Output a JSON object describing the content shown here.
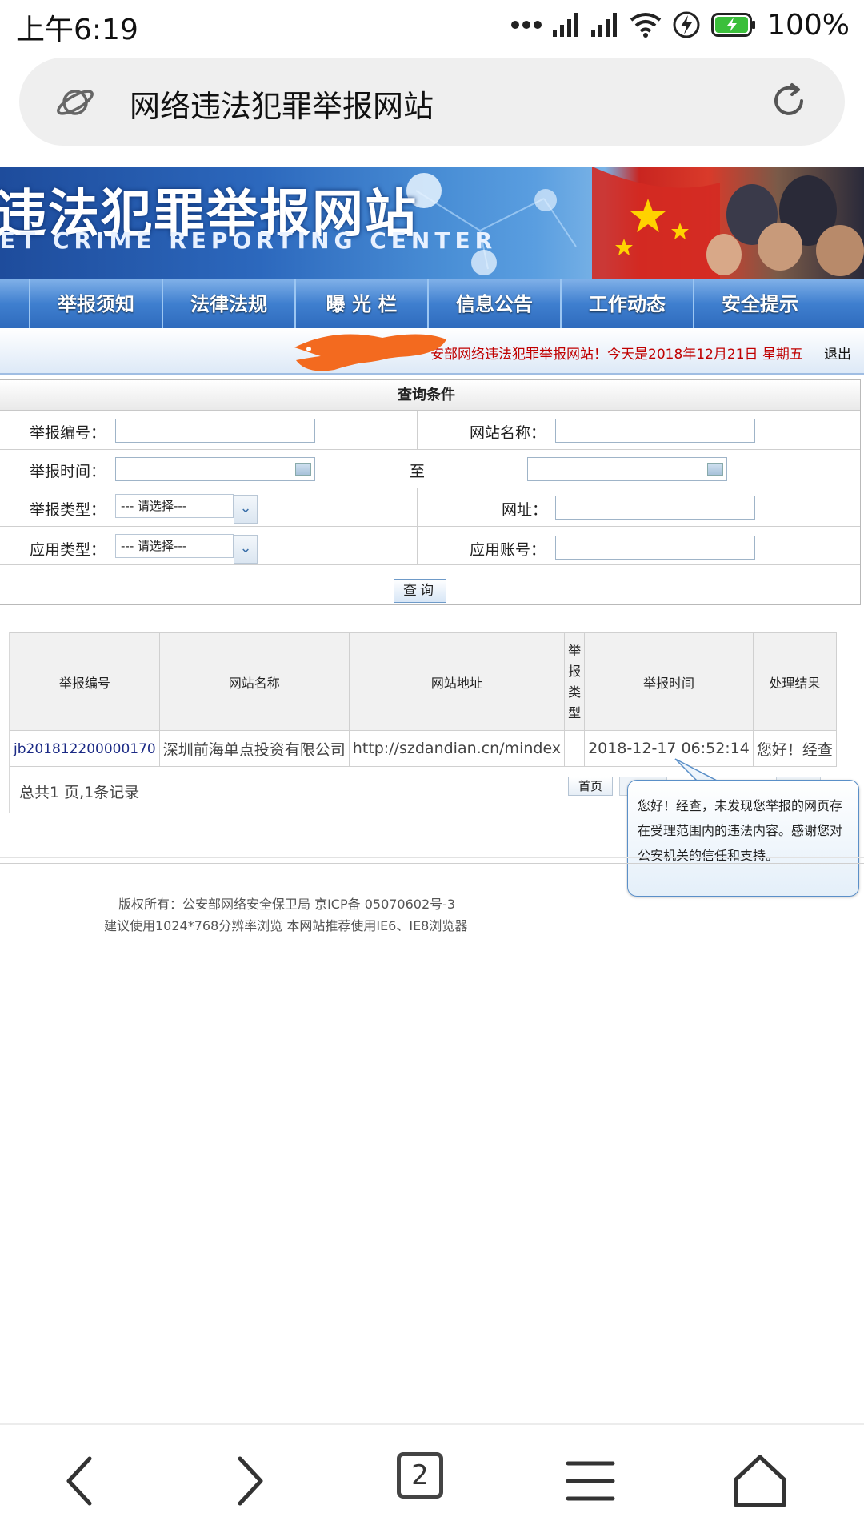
{
  "status_bar": {
    "time": "上午6:19",
    "battery": "100%",
    "icons": [
      "more-dots-icon",
      "signal-icon",
      "signal-icon",
      "wifi-icon",
      "charging-icon",
      "battery-icon"
    ]
  },
  "address_bar": {
    "title": "网络违法犯罪举报网站",
    "left_icon": "planet-icon",
    "right_icon": "refresh-icon"
  },
  "banner": {
    "title": "违法犯罪举报网站",
    "subtitle": "ET CRIME REPORTING CENTER"
  },
  "nav": {
    "items": [
      {
        "label": "举报须知"
      },
      {
        "label": "法律法规"
      },
      {
        "label": "曝 光 栏"
      },
      {
        "label": "信息公告"
      },
      {
        "label": "工作动态"
      },
      {
        "label": "安全提示"
      }
    ]
  },
  "welcome": {
    "text": "安部网络违法犯罪举报网站！今天是2018年12月21日 星期五",
    "logout": "退出"
  },
  "query_form": {
    "header": "查询条件",
    "report_id_label": "举报编号：",
    "site_name_label": "网站名称：",
    "report_time_label": "举报时间：",
    "to_label": "至",
    "report_type_label": "举报类型：",
    "url_label": "网址：",
    "app_type_label": "应用类型：",
    "app_account_label": "应用账号：",
    "report_type_select": "--- 请选择---",
    "app_type_select": "--- 请选择---",
    "query_button": "查询"
  },
  "results": {
    "headers": {
      "report_id": "举报编号",
      "site_name": "网站名称",
      "site_url": "网站地址",
      "report_type": "举报类型",
      "report_time": "举报时间",
      "result": "处理结果"
    },
    "rows": [
      {
        "report_id": "jb201812200000170",
        "site_name": "深圳前海单点投资有限公司",
        "site_url": "http://szdandian.cn/mindex",
        "report_type": "",
        "report_time": "2018-12-17 06:52:14",
        "result": "您好！经查"
      }
    ],
    "summary": "总共1 页,1条记录",
    "first_page": "首页"
  },
  "tooltip": {
    "text": "您好！经查，未发现您举报的网页存在受理范围内的违法内容。感谢您对公安机关的信任和支持。"
  },
  "footer": {
    "line1": "版权所有：公安部网络安全保卫局 京ICP备 05070602号-3",
    "line2": "建议使用1024*768分辨率浏览 本网站推荐使用IE6、IE8浏览器"
  },
  "bottom_nav": {
    "tab_count": "2",
    "icons": [
      "back-icon",
      "forward-icon",
      "tabs-icon",
      "menu-icon",
      "home-icon"
    ]
  },
  "colors": {
    "banner_blue": "#2c68bd",
    "nav_blue": "#3f7fcf",
    "welcome_red": "#c00000",
    "link_blue": "#1b2a85",
    "scribble_orange": "#f36a1f"
  }
}
